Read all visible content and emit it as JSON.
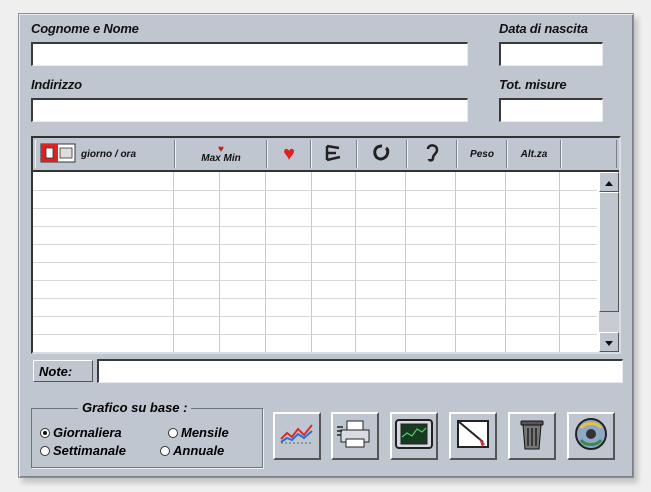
{
  "form": {
    "name_label": "Cognome e Nome",
    "birth_label": "Data di nascita",
    "address_label": "Indirizzo",
    "total_label": "Tot. misure",
    "note_label": "Note:"
  },
  "grid": {
    "columns": [
      {
        "label": "giorno / ora",
        "icon": "calendar-icon"
      },
      {
        "label": "Max Min",
        "icon": "max-min-icon"
      },
      {
        "label": "",
        "icon": "heart-icon"
      },
      {
        "label": "",
        "icon": "gauge-icon"
      },
      {
        "label": "",
        "icon": "lungs-icon"
      },
      {
        "label": "",
        "icon": "ear-icon"
      },
      {
        "label": "Peso",
        "icon": ""
      },
      {
        "label": "Alt.za",
        "icon": ""
      }
    ]
  },
  "chart_group": {
    "title": "Grafico su base :",
    "options": [
      "Giornaliera",
      "Mensile",
      "Settimanale",
      "Annuale"
    ],
    "selected": "Giornaliera"
  },
  "toolbar": {
    "icons": [
      "chart-icon",
      "printer-icon",
      "monitor-icon",
      "edit-icon",
      "trash-icon",
      "exit-icon"
    ]
  }
}
